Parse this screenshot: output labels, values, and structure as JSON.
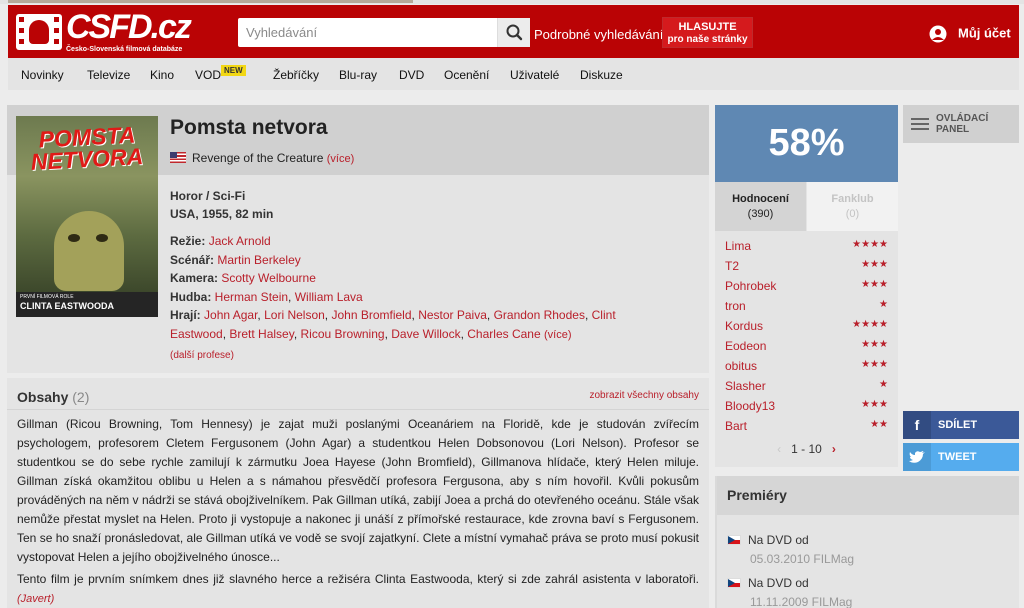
{
  "header": {
    "logo_text": "CSFD.cz",
    "logo_tagline": "Česko-Slovenská filmová databáze",
    "search_placeholder": "Vyhledávání",
    "advanced_search": "Podrobné vyhledávání",
    "vote_line1": "HLASUJTE",
    "vote_line2": "pro naše stránky",
    "account": "Můj účet"
  },
  "nav": {
    "items": [
      "Novinky",
      "Televize",
      "Kino",
      "VOD",
      "Žebříčky",
      "Blu-ray",
      "DVD",
      "Ocenění",
      "Uživatelé",
      "Diskuze"
    ],
    "vod_badge": "NEW"
  },
  "film": {
    "title": "Pomsta netvora",
    "alt_title": "Revenge of the Creature",
    "alt_more": "(více)",
    "genre": "Horor / Sci-Fi",
    "origin": "USA, 1955, 82 min",
    "poster": {
      "title_line1": "POMSTA",
      "title_line2": "NETVORA",
      "small_text": "PRVNÍ FILMOVÁ ROLE",
      "name_text": "CLINTA EASTWOODA"
    },
    "credits": {
      "director_label": "Režie:",
      "director": "Jack Arnold",
      "writer_label": "Scénář:",
      "writer": "Martin Berkeley",
      "camera_label": "Kamera:",
      "camera": "Scotty Welbourne",
      "music_label": "Hudba:",
      "music": [
        "Herman Stein",
        "William Lava"
      ],
      "cast_label": "Hrají:",
      "cast": [
        "John Agar",
        "Lori Nelson",
        "John Bromfield",
        "Nestor Paiva",
        "Grandon Rhodes",
        "Clint Eastwood",
        "Brett Halsey",
        "Ricou Browning",
        "Dave Willock",
        "Charles Cane"
      ],
      "cast_more": "(více)",
      "other_roles": "(další profese)"
    }
  },
  "plot": {
    "heading": "Obsahy",
    "count": "(2)",
    "show_all": "zobrazit všechny obsahy",
    "text1": "Gillman (Ricou Browning, Tom Hennesy) je zajat muži poslanými Oceanáriem na Floridě, kde je studován zvířecím psychologem, profesorem Cletem Fergusonem (John Agar) a studentkou Helen Dobsonovou (Lori Nelson). Profesor se studentkou se do sebe rychle zamilují k zármutku Joea Hayese (John Bromfield), Gillmanova hlídače, který Helen miluje. Gillman získá okamžitou oblibu u Helen a s námahou přesvědčí profesora Fergusona, aby s ním hovořil. Kvůli pokusům prováděných na něm v nádrži se stává obojživelníkem. Pak Gillman utíká, zabijí Joea a prchá do otevřeného oceánu. Stále však nemůže přestat myslet na Helen. Proto ji vystopuje a nakonec ji unáší z přímořské restaurace, kde zrovna baví s Fergusonem. Ten se ho snaží pronásledovat, ale Gillman utíká ve vodě se svojí zajatkyní. Clete a místní vymahač práva se proto musí pokusit vystopovat Helen a jejího obojživelného únosce...",
    "text2": "Tento film je prvním snímkem dnes již slavného herce a režiséra Clinta Eastwooda, který si zde zahrál asistenta v laboratoři.",
    "author": "(Javert)"
  },
  "rating": {
    "percent": "58%",
    "tab1_label": "Hodnocení",
    "tab1_count": "(390)",
    "tab2_label": "Fanklub",
    "tab2_count": "(0)",
    "users": [
      {
        "name": "Lima",
        "stars": "★★★★"
      },
      {
        "name": "T2",
        "stars": "★★★"
      },
      {
        "name": "Pohrobek",
        "stars": "★★★"
      },
      {
        "name": "tron",
        "stars": "★"
      },
      {
        "name": "Kordus",
        "stars": "★★★★"
      },
      {
        "name": "Eodeon",
        "stars": "★★★"
      },
      {
        "name": "obitus",
        "stars": "★★★"
      },
      {
        "name": "Slasher",
        "stars": "★"
      },
      {
        "name": "Bloody13",
        "stars": "★★★"
      },
      {
        "name": "Bart",
        "stars": "★★"
      }
    ],
    "pager": "1 - 10",
    "prev": "‹",
    "next": "›"
  },
  "sidebar": {
    "control_panel_line1": "OVLÁDACÍ",
    "control_panel_line2": "PANEL",
    "share_label": "SDÍLET",
    "tweet_label": "TWEET"
  },
  "premieres": {
    "heading": "Premiéry",
    "entries": [
      {
        "label": "Na DVD od",
        "date": "05.03.2010 FILMag"
      },
      {
        "label": "Na DVD od",
        "date": "11.11.2009 FILMag"
      }
    ]
  },
  "colors": {
    "brand_red": "#ba0305",
    "rating_blue": "#5f88b3",
    "link_red": "#b9202b",
    "facebook": "#3b5998",
    "twitter": "#55acee"
  }
}
